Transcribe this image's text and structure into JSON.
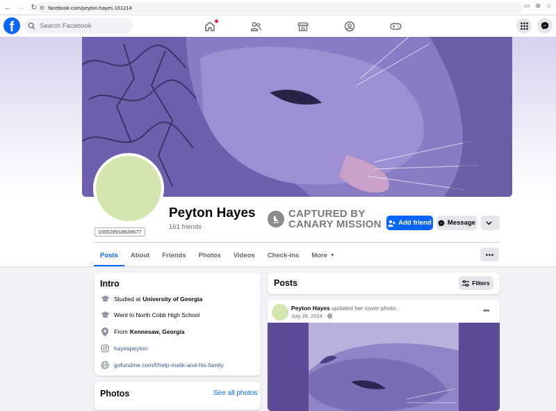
{
  "browser": {
    "url": "facebook.com/peyton.hayes.161214"
  },
  "header": {
    "search_placeholder": "Search Facebook",
    "nav_icons": [
      "home-icon",
      "friends-icon",
      "marketplace-icon",
      "groups-icon",
      "gaming-icon"
    ],
    "right_icons": [
      "menu-grid-icon",
      "messenger-icon"
    ]
  },
  "profile": {
    "name": "Peyton Hayes",
    "friends": "161 friends",
    "id_tag": "100028918628677",
    "watermark_line1": "CAPTURED BY",
    "watermark_line2": "CANARY MISSION",
    "add_friend_label": "Add friend",
    "message_label": "Message"
  },
  "tabs": [
    {
      "label": "Posts",
      "active": true
    },
    {
      "label": "About"
    },
    {
      "label": "Friends"
    },
    {
      "label": "Photos"
    },
    {
      "label": "Videos"
    },
    {
      "label": "Check-ins"
    },
    {
      "label": "More"
    }
  ],
  "intro": {
    "title": "Intro",
    "studied_prefix": "Studied at",
    "studied_school": "University of Georgia",
    "went_to": "Went to North Cobb High School",
    "from_prefix": "From",
    "from_place": "Kennesaw, Georgia",
    "instagram": "hayespeyton",
    "link": "gofundme.com/f/help-malik-and-his-family"
  },
  "photos": {
    "title": "Photos",
    "see_all": "See all photos"
  },
  "posts": {
    "title": "Posts",
    "filters_label": "Filters",
    "post": {
      "author": "Peyton Hayes",
      "action": "updated her cover photo.",
      "date": "July 28, 2024 ·"
    }
  },
  "colors": {
    "brand_blue": "#0866ff",
    "avatar_green": "#d4e5b0",
    "cover_purple": "#6c5aa8"
  }
}
